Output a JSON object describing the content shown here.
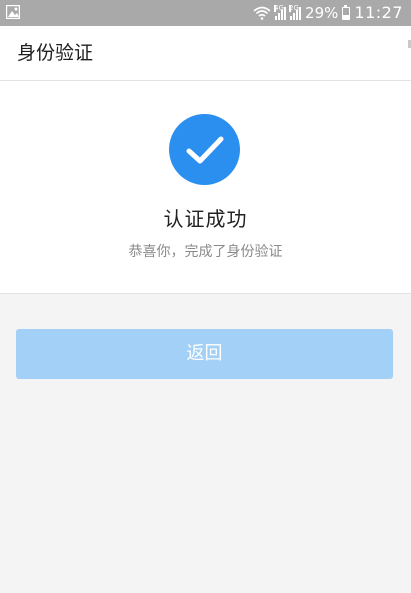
{
  "status_bar": {
    "network_label": "4G",
    "network_label_2": "2G",
    "battery_text": "29%",
    "battery_level": 0.29,
    "clock": "11:27"
  },
  "header": {
    "title": "身份验证"
  },
  "result": {
    "icon": "check-circle-icon",
    "title": "认证成功",
    "subtitle": "恭喜你，完成了身份验证"
  },
  "actions": {
    "back_label": "返回"
  },
  "colors": {
    "status_bar_bg": "#a9a9a9",
    "accent_blue": "#2b8ff0",
    "button_bg": "#a3d0f7",
    "page_bg": "#f4f4f4"
  }
}
